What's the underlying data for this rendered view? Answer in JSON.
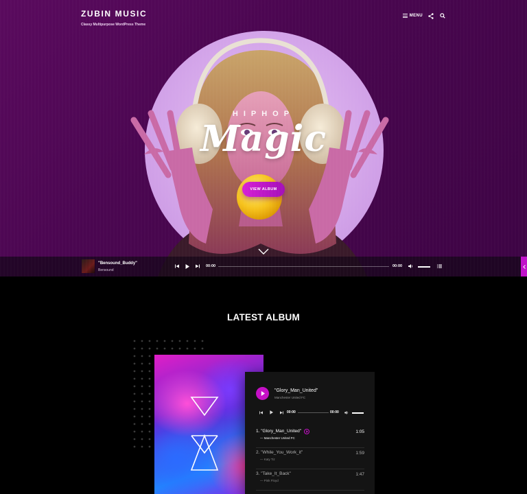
{
  "site": {
    "title": "ZUBIN MUSIC",
    "tagline": "Classy Multipurpose WordPress Theme"
  },
  "nav": {
    "menu_label": "MENU",
    "icons": [
      "hamburger-icon",
      "share-icon",
      "search-icon"
    ]
  },
  "hero": {
    "kicker": "HIPHOP",
    "headline": "Magic",
    "cta_label": "VIEW ALBUM",
    "scroll_icon": "chevron-down-icon"
  },
  "player": {
    "track_title": "\"Bensound_Buddy\"",
    "artist": "Bensound",
    "current_time": "00:00",
    "duration": "00:00",
    "progress": 0,
    "icons": [
      "skip-back-icon",
      "play-icon",
      "skip-forward-icon",
      "volume-icon",
      "playlist-icon"
    ]
  },
  "latest_album": {
    "heading": "LATEST ALBUM",
    "player": {
      "track_title": "\"Glory_Man_United\"",
      "artist": "Manchester United FC",
      "current_time": "00:00",
      "duration": "00:00"
    },
    "tracklist": [
      {
        "name": "1. \"Glory_Man_United\"",
        "artist": "— Manchester United FC",
        "duration": "1:05",
        "active": true
      },
      {
        "name": "2. \"While_You_Work_it\"",
        "artist": "— Katy Tiz",
        "duration": "1:59",
        "active": false
      },
      {
        "name": "3. \"Take_It_Back\"",
        "artist": "— Pink Floyd",
        "duration": "1:47",
        "active": false
      }
    ]
  },
  "colors": {
    "accent": "#c510c6",
    "hero_bg": "#4a0650",
    "disc": "#d4a6ea",
    "page_bg": "#000000",
    "card_bg": "#141414"
  }
}
